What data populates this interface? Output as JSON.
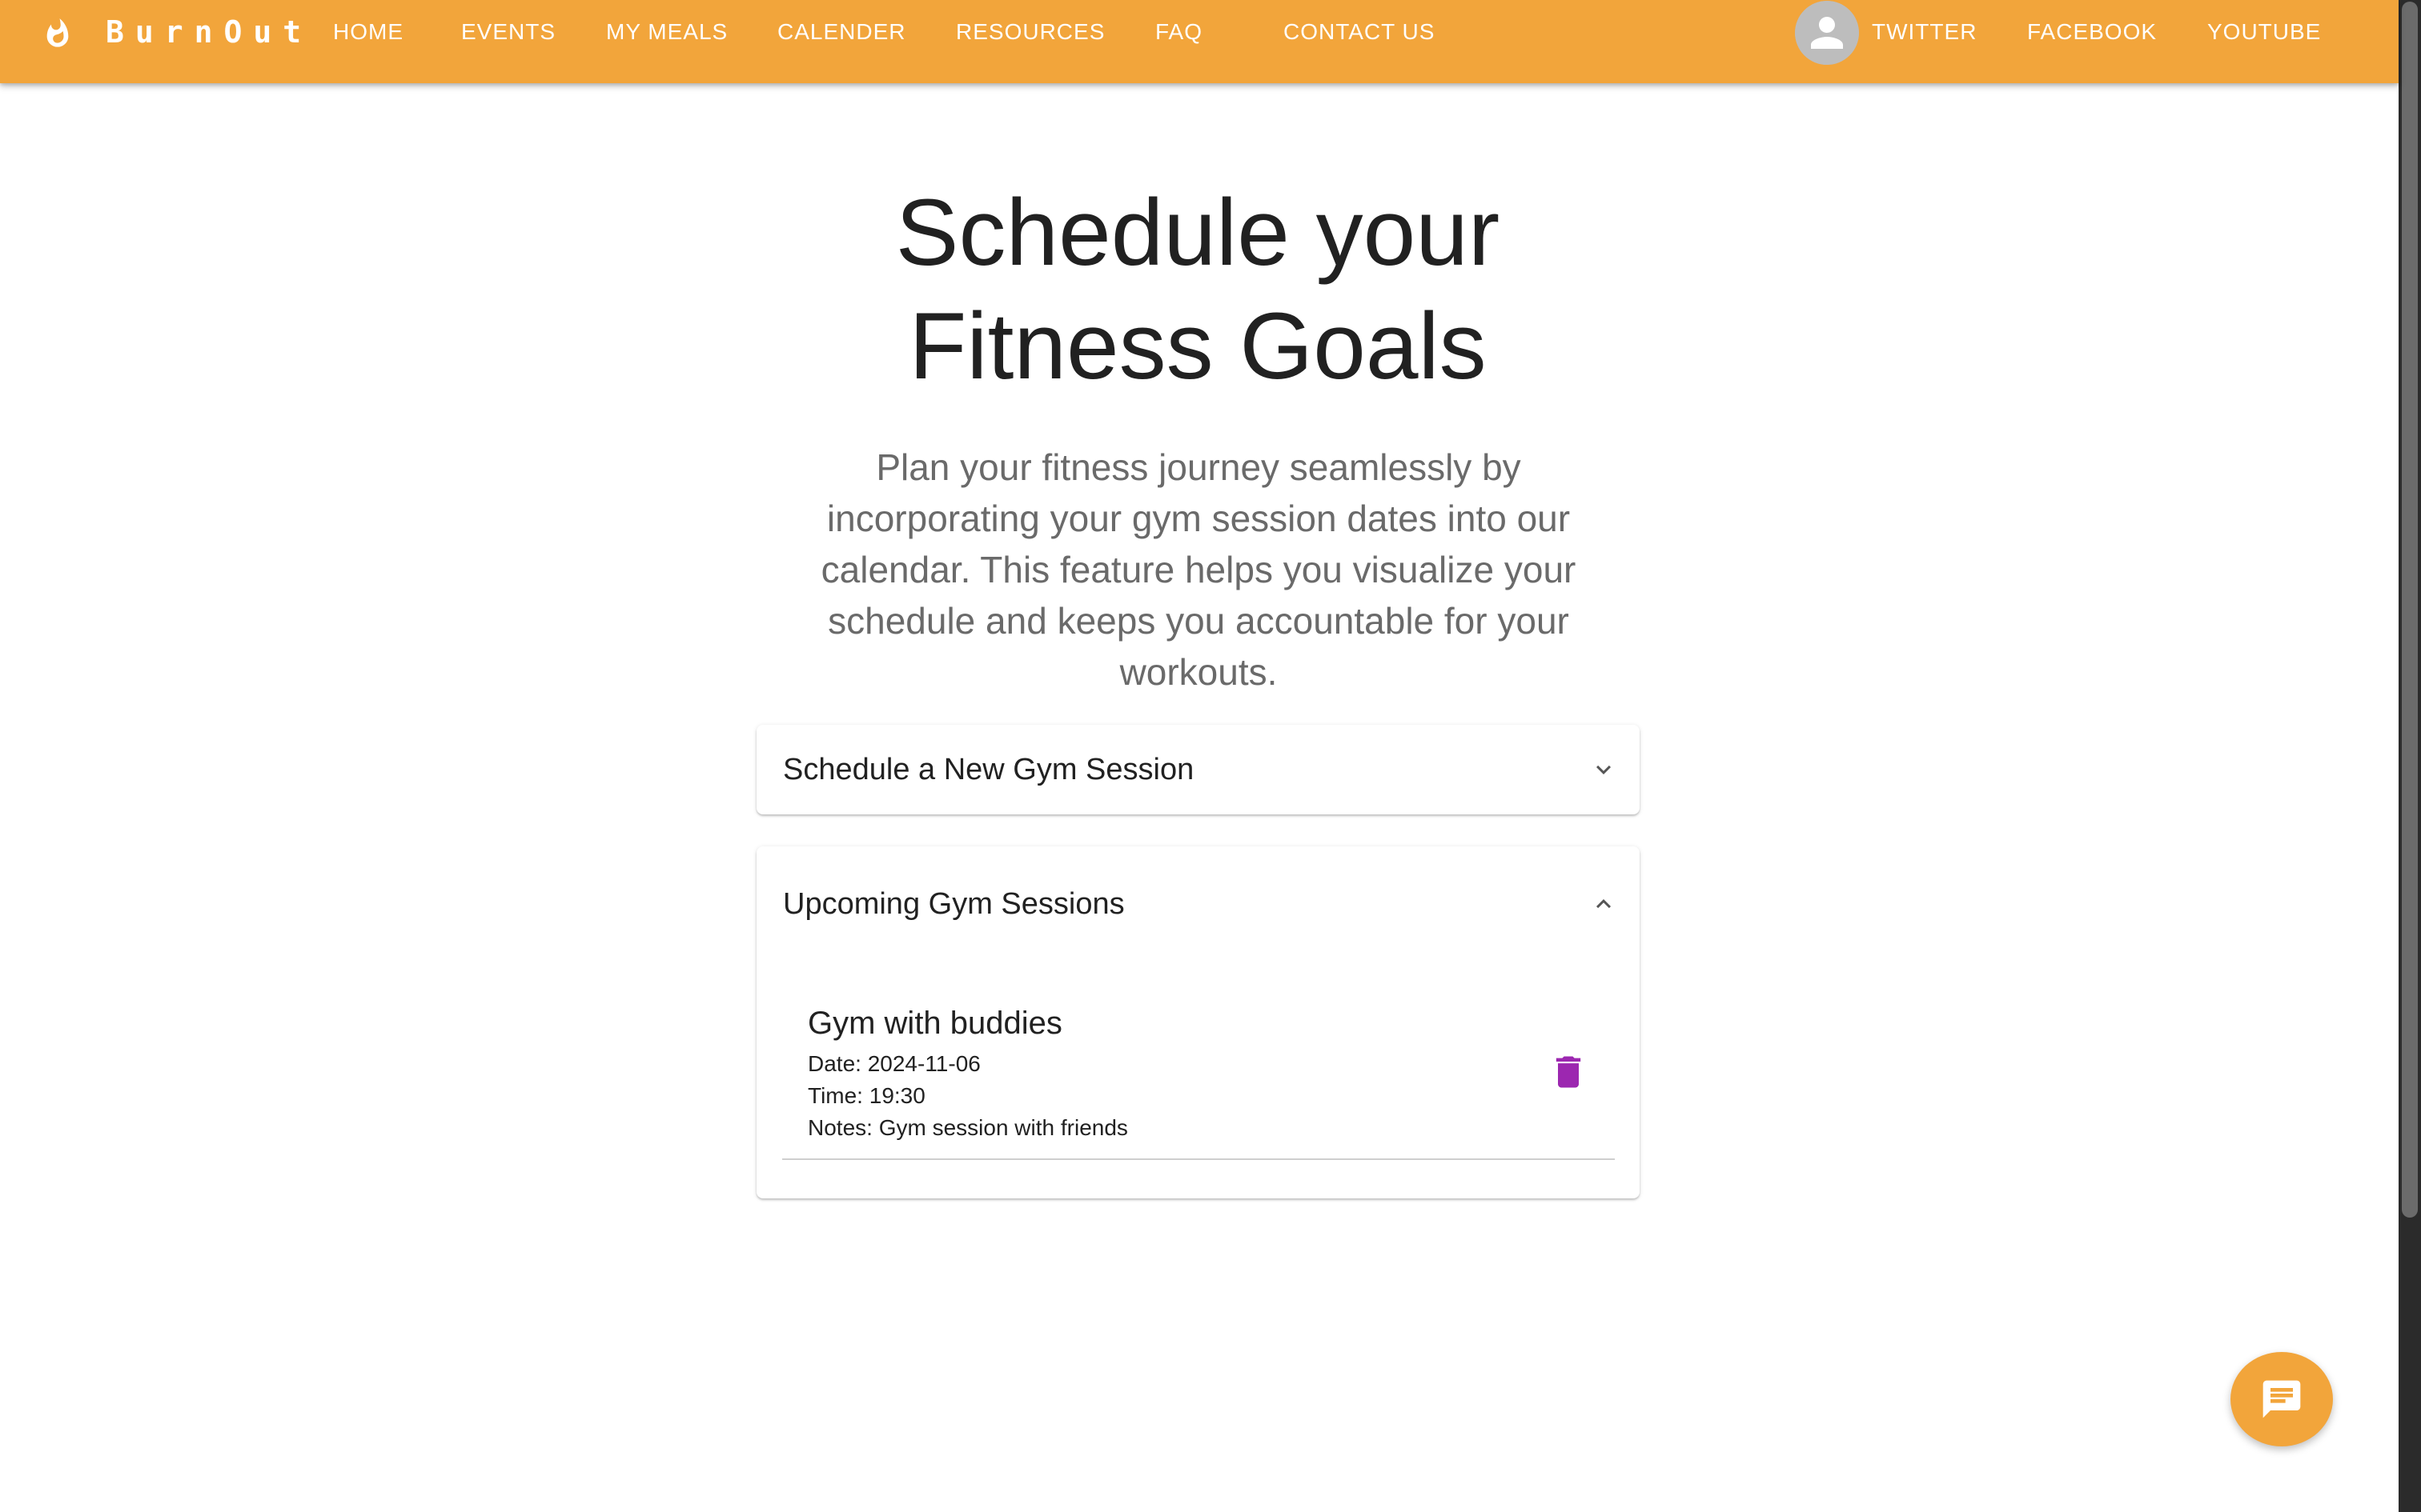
{
  "brand": {
    "name": "BurnOut",
    "logo_icon": "flame-icon",
    "color": "#f2a53b"
  },
  "nav": {
    "home": "HOME",
    "events": "EVENTS",
    "my_meals": "MY MEALS",
    "calender": "CALENDER",
    "resources": "RESOURCES",
    "faq": "FAQ",
    "contact": "CONTACT US"
  },
  "social": {
    "avatar_icon": "user-avatar-icon",
    "twitter": "TWITTER",
    "facebook": "FACEBOOK",
    "youtube": "YOUTUBE"
  },
  "hero": {
    "title_line1": "Schedule your",
    "title_line2": "Fitness Goals",
    "desc_line1": "Plan your fitness journey seamlessly by",
    "desc_line2": "incorporating your gym session dates into our",
    "desc_line3": "calendar. This feature helps you visualize your",
    "desc_line4": "schedule and keeps you accountable for your",
    "desc_line5": "workouts."
  },
  "schedule_panel": {
    "title": "Schedule a New Gym Session",
    "expanded": false,
    "icon": "chevron-down-icon"
  },
  "upcoming_panel": {
    "title": "Upcoming Gym Sessions",
    "expanded": true,
    "icon": "chevron-up-icon",
    "sessions": [
      {
        "title": "Gym with buddies",
        "date": "Date: 2024-11-06",
        "time": "Time: 19:30",
        "notes": "Notes: Gym session with friends",
        "delete_icon": "trash-icon",
        "delete_color": "#9c27b0"
      }
    ]
  },
  "chat": {
    "icon": "chat-icon"
  }
}
